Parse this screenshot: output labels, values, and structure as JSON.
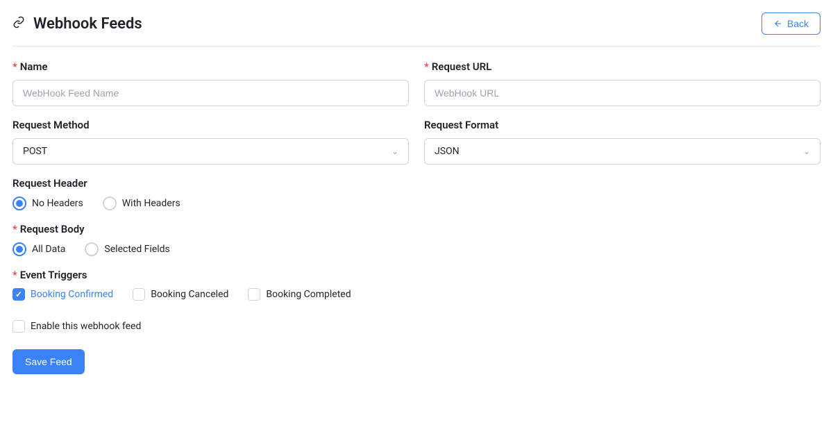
{
  "header": {
    "title": "Webhook Feeds",
    "back_label": "Back"
  },
  "fields": {
    "name": {
      "label": "Name",
      "placeholder": "WebHook Feed Name",
      "value": "",
      "required": true
    },
    "url": {
      "label": "Request URL",
      "placeholder": "WebHook URL",
      "value": "",
      "required": true
    },
    "method": {
      "label": "Request Method",
      "value": "POST"
    },
    "format": {
      "label": "Request Format",
      "value": "JSON"
    },
    "header_section": {
      "label": "Request Header",
      "options": [
        "No Headers",
        "With Headers"
      ],
      "selected": "No Headers"
    },
    "body": {
      "label": "Request Body",
      "required": true,
      "options": [
        "All Data",
        "Selected Fields"
      ],
      "selected": "All Data"
    },
    "triggers": {
      "label": "Event Triggers",
      "required": true,
      "options": [
        {
          "label": "Booking Confirmed",
          "checked": true
        },
        {
          "label": "Booking Canceled",
          "checked": false
        },
        {
          "label": "Booking Completed",
          "checked": false
        }
      ]
    },
    "enable": {
      "label": "Enable this webhook feed",
      "checked": false
    }
  },
  "actions": {
    "save": "Save Feed"
  }
}
